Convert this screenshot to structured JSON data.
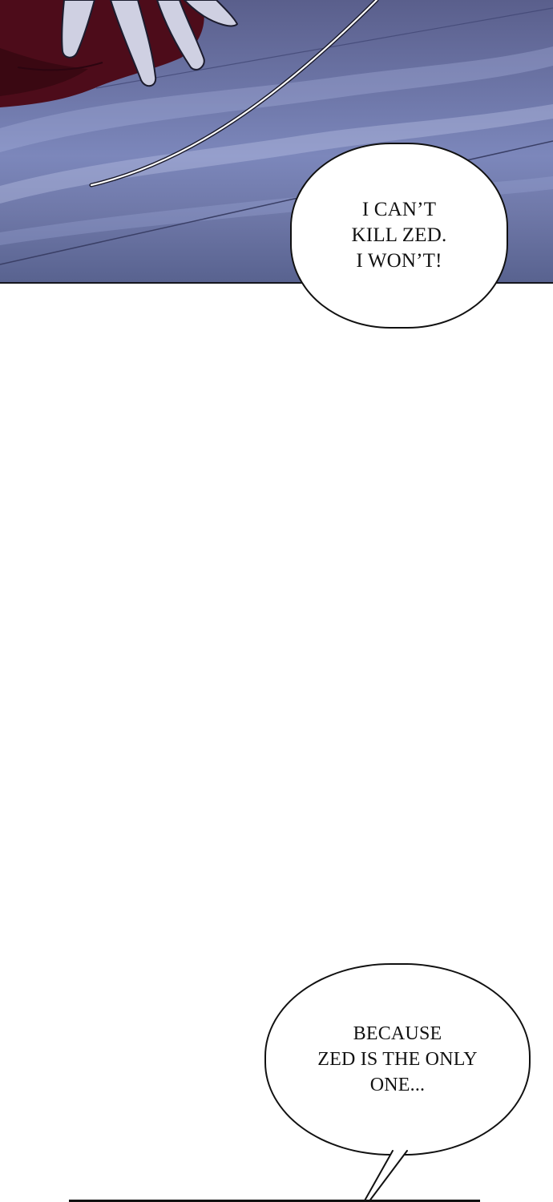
{
  "panels": [
    {
      "bubble_text": "I CAN’T\nKILL ZED.\nI WON’T!"
    },
    {
      "bubble_text": "BECAUSE\nZED IS THE ONLY\nONE..."
    }
  ],
  "colors": {
    "night_sky": "#6f78aa",
    "sleeve_red": "#5a0f1d",
    "glove_white": "#cfd0e2",
    "ink": "#111111",
    "background": "#ffffff"
  }
}
